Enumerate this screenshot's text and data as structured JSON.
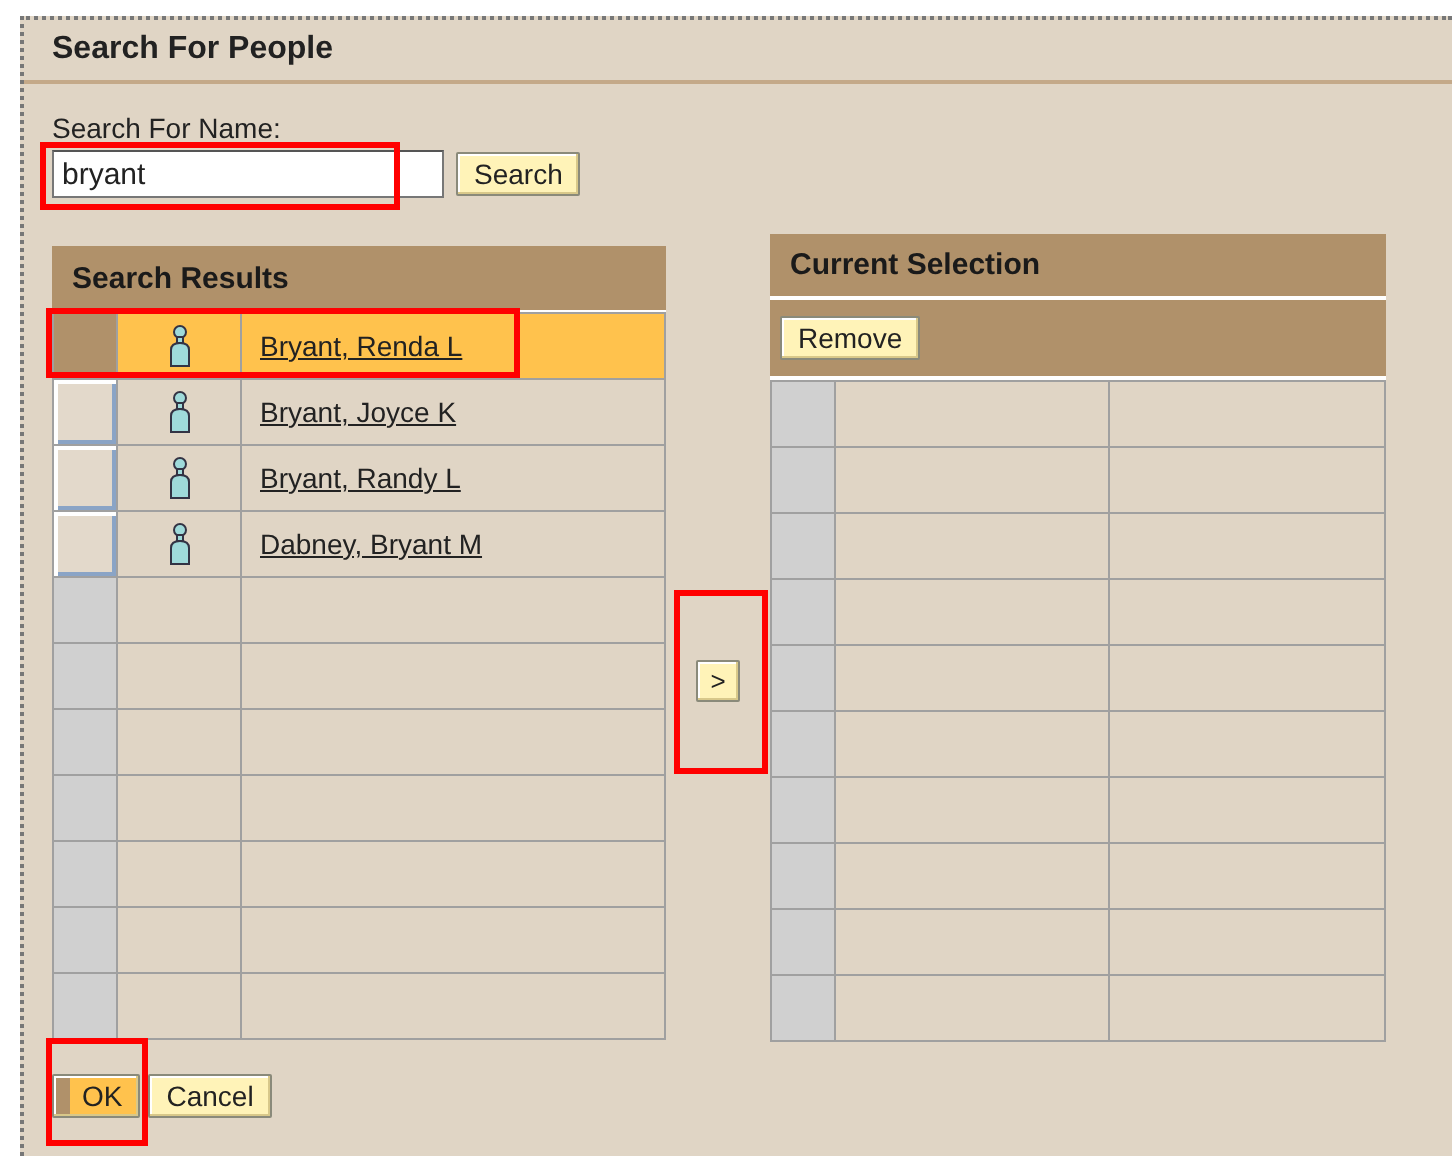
{
  "dialog": {
    "title": "Search For People"
  },
  "search": {
    "label": "Search For Name:",
    "value": "bryant",
    "highlighted": true,
    "button": "Search"
  },
  "results": {
    "title": "Search Results",
    "rows": [
      {
        "name": "Bryant, Renda L",
        "selected": true,
        "highlighted": true
      },
      {
        "name": "Bryant, Joyce K",
        "selected": false,
        "highlighted": false
      },
      {
        "name": "Bryant, Randy L",
        "selected": false,
        "highlighted": false
      },
      {
        "name": "Dabney, Bryant M",
        "selected": false,
        "highlighted": false
      }
    ]
  },
  "move_button": {
    "label": ">",
    "highlighted": true
  },
  "selection": {
    "title": "Current Selection",
    "button": "Remove"
  },
  "footer": {
    "buttons": [
      {
        "label": "OK",
        "kind": "primary",
        "highlighted": true
      },
      {
        "label": "Cancel",
        "kind": "normal",
        "highlighted": false
      }
    ]
  }
}
